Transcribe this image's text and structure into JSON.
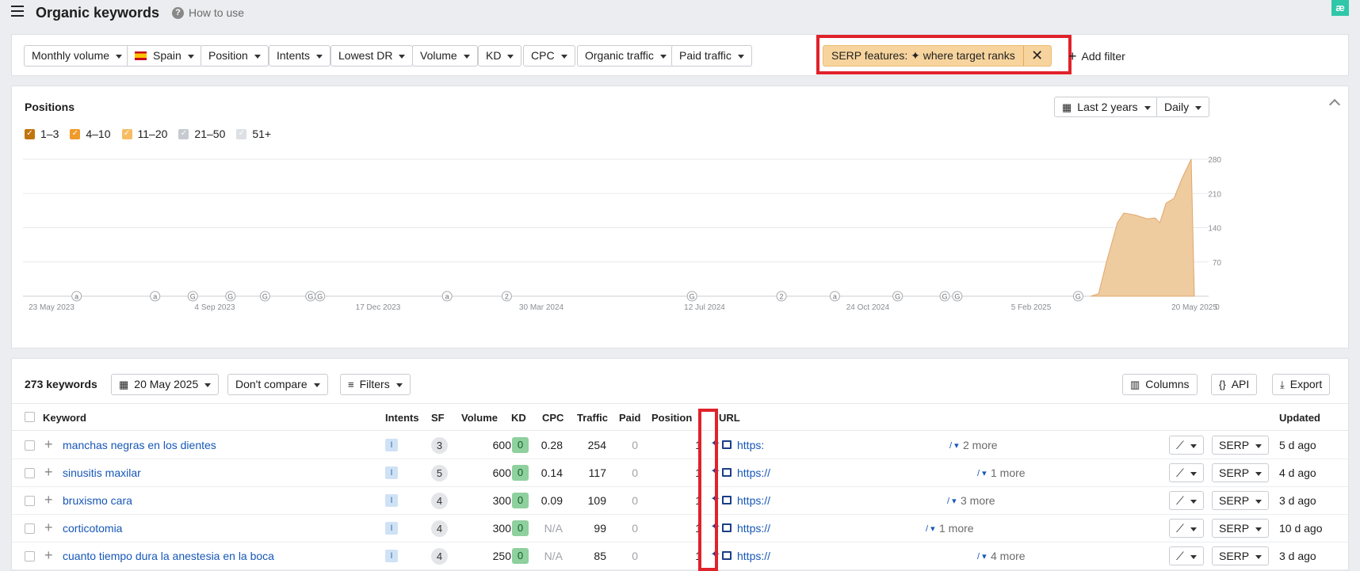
{
  "header": {
    "title": "Organic keywords",
    "how_to": "How to use",
    "brand": "æ"
  },
  "filters": {
    "items": [
      "Monthly volume",
      "Spain",
      "Position",
      "Intents",
      "Lowest DR",
      "Volume",
      "KD",
      "CPC",
      "Organic traffic",
      "Paid traffic"
    ],
    "serp_prefix": "SERP features:",
    "serp_suffix": "where target ranks",
    "add_filter": "Add filter"
  },
  "positions": {
    "title": "Positions",
    "legend": [
      {
        "label": "1–3",
        "color": "#c1750c",
        "checked": true
      },
      {
        "label": "4–10",
        "color": "#f09a2a",
        "checked": true
      },
      {
        "label": "11–20",
        "color": "#f7bd62",
        "checked": true
      },
      {
        "label": "21–50",
        "color": "#c7cbd1",
        "checked": true
      },
      {
        "label": "51+",
        "color": "#dde0e4",
        "checked": true
      }
    ],
    "range": "Last 2 years",
    "granularity": "Daily"
  },
  "chart_data": {
    "type": "area",
    "y_ticks": [
      "280",
      "210",
      "140",
      "70",
      "0"
    ],
    "x_ticks": [
      "23 May 2023",
      "4 Sep 2023",
      "17 Dec 2023",
      "30 Mar 2024",
      "12 Jul 2024",
      "24 Oct 2024",
      "5 Feb 2025",
      "20 May 2025"
    ],
    "ylim": [
      0,
      280
    ],
    "grid": true,
    "series": [
      {
        "values": [
          {
            "x": "2025-03-15",
            "y": 0
          },
          {
            "x": "2025-03-20",
            "y": 5
          },
          {
            "x": "2025-03-25",
            "y": 70
          },
          {
            "x": "2025-04-01",
            "y": 150
          },
          {
            "x": "2025-04-05",
            "y": 170
          },
          {
            "x": "2025-04-12",
            "y": 166
          },
          {
            "x": "2025-04-20",
            "y": 158
          },
          {
            "x": "2025-04-25",
            "y": 160
          },
          {
            "x": "2025-04-28",
            "y": 150
          },
          {
            "x": "2025-05-02",
            "y": 190
          },
          {
            "x": "2025-05-07",
            "y": 200
          },
          {
            "x": "2025-05-12",
            "y": 240
          },
          {
            "x": "2025-05-18",
            "y": 280
          },
          {
            "x": "2025-05-20",
            "y": 0
          }
        ],
        "color": "#efcba0"
      }
    ],
    "annotations": [
      "a",
      "a",
      "G",
      "G",
      "G",
      "G",
      "G",
      "a",
      "2",
      "G",
      "2",
      "a",
      "G",
      "G",
      "G",
      "G"
    ]
  },
  "table": {
    "count": "273 keywords",
    "date": "20 May 2025",
    "compare": "Don't compare",
    "filters": "Filters",
    "columns_btn": "Columns",
    "api_btn": "API",
    "export_btn": "Export",
    "headers": {
      "keyword": "Keyword",
      "intents": "Intents",
      "sf": "SF",
      "volume": "Volume",
      "kd": "KD",
      "cpc": "CPC",
      "traffic": "Traffic",
      "paid": "Paid",
      "position": "Position",
      "url": "URL",
      "updated": "Updated"
    },
    "rows": [
      {
        "keyword": "manchas negras en los dientes",
        "intent": "I",
        "sf": "3",
        "volume": "600",
        "kd": "0",
        "cpc": "0.28",
        "traffic": "254",
        "paid": "0",
        "position": "1",
        "url": "https:",
        "more": "2 more",
        "serp": "SERP",
        "updated": "5 d ago"
      },
      {
        "keyword": "sinusitis maxilar",
        "intent": "I",
        "sf": "5",
        "volume": "600",
        "kd": "0",
        "cpc": "0.14",
        "traffic": "117",
        "paid": "0",
        "position": "1",
        "url": "https://",
        "more": "1 more",
        "serp": "SERP",
        "updated": "4 d ago"
      },
      {
        "keyword": "bruxismo cara",
        "intent": "I",
        "sf": "4",
        "volume": "300",
        "kd": "0",
        "cpc": "0.09",
        "traffic": "109",
        "paid": "0",
        "position": "1",
        "url": "https://",
        "more": "3 more",
        "serp": "SERP",
        "updated": "3 d ago"
      },
      {
        "keyword": "corticotomia",
        "intent": "I",
        "sf": "4",
        "volume": "300",
        "kd": "0",
        "cpc": "N/A",
        "traffic": "99",
        "paid": "0",
        "position": "1",
        "url": "https://",
        "more": "1 more",
        "serp": "SERP",
        "updated": "10 d ago"
      },
      {
        "keyword": "cuanto tiempo dura la anestesia en la boca",
        "intent": "I",
        "sf": "4",
        "volume": "250",
        "kd": "0",
        "cpc": "N/A",
        "traffic": "85",
        "paid": "0",
        "position": "1",
        "url": "https://",
        "more": "4 more",
        "serp": "SERP",
        "updated": "3 d ago"
      }
    ]
  }
}
